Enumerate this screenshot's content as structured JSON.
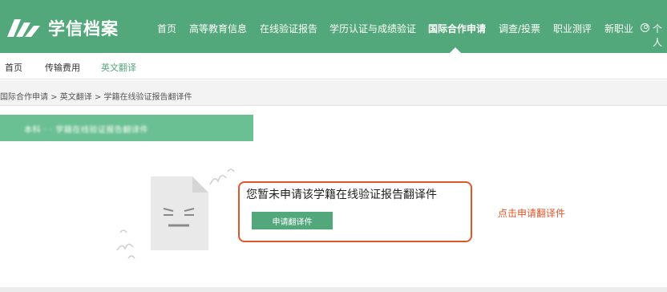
{
  "brand": {
    "name": "学信档案"
  },
  "topnav": {
    "items": [
      {
        "label": "首页"
      },
      {
        "label": "高等教育信息"
      },
      {
        "label": "在线验证报告"
      },
      {
        "label": "学历认证与成绩验证"
      },
      {
        "label": "国际合作申请",
        "active": true
      },
      {
        "label": "调查/投票"
      },
      {
        "label": "职业测评"
      },
      {
        "label": "新职业"
      }
    ],
    "user_label": "个人"
  },
  "subnav": {
    "items": [
      {
        "label": "首页"
      },
      {
        "label": "传输费用"
      },
      {
        "label": "英文翻译",
        "active": true
      }
    ]
  },
  "breadcrumb": {
    "text": "国际合作申请 > 英文翻译 > 学籍在线验证报告翻译件"
  },
  "notice": {
    "text": "本科 · · 学籍在线验证报告翻译件"
  },
  "empty_state": {
    "message": "您暂未申请该学籍在线验证报告翻译件",
    "button_label": "申请翻译件"
  },
  "annotation": {
    "hint": "点击申请翻译件"
  },
  "colors": {
    "brand_green": "#52a87a",
    "notice_green": "#6bc093",
    "annotation_red": "#e0562c"
  }
}
